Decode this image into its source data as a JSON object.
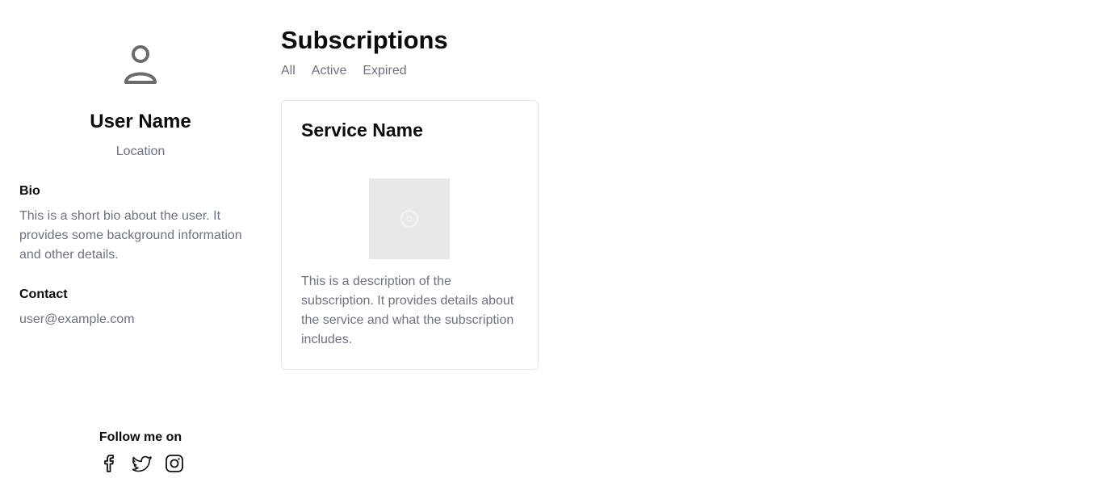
{
  "profile": {
    "name": "User Name",
    "location": "Location",
    "bio_title": "Bio",
    "bio_text": "This is a short bio about the user. It provides some background information and other details.",
    "contact_title": "Contact",
    "email": "user@example.com",
    "follow_label": "Follow me on",
    "socials": [
      "facebook-icon",
      "twitter-icon",
      "instagram-icon"
    ]
  },
  "main": {
    "title": "Subscriptions",
    "tabs": [
      {
        "label": "All"
      },
      {
        "label": "Active"
      },
      {
        "label": "Expired"
      }
    ],
    "cards": [
      {
        "title": "Service Name",
        "image_icon": "image-placeholder-icon",
        "description": "This is a description of the subscription. It provides details about the service and what the subscription includes."
      }
    ]
  },
  "colors": {
    "text_primary": "#0b0b0b",
    "text_muted": "#6b7280",
    "border": "#e5e7eb",
    "placeholder_bg": "#e8e8e8"
  }
}
